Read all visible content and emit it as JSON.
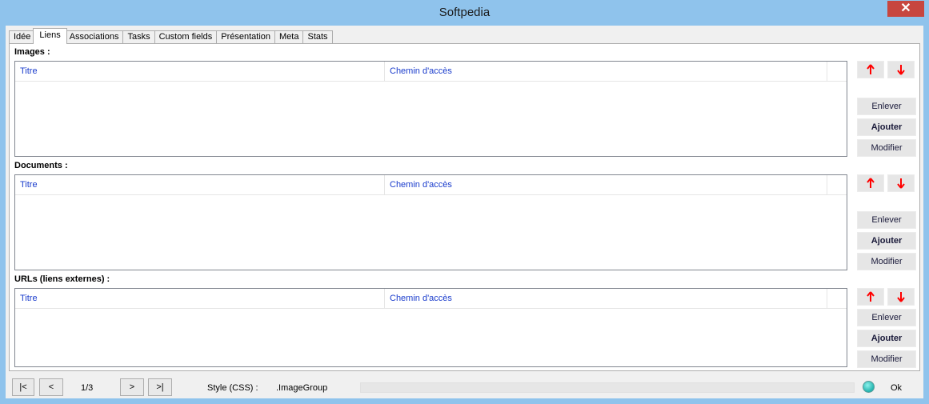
{
  "window": {
    "title": "Softpedia",
    "close_label": "✕"
  },
  "tabs": [
    {
      "label": "Idée"
    },
    {
      "label": "Liens"
    },
    {
      "label": "Associations"
    },
    {
      "label": "Tasks"
    },
    {
      "label": "Custom fields"
    },
    {
      "label": "Présentation"
    },
    {
      "label": "Meta"
    },
    {
      "label": "Stats"
    }
  ],
  "active_tab": "Liens",
  "sections": [
    {
      "label": "Images :",
      "col_titre": "Titre",
      "col_chemin": "Chemin d'accès",
      "btn_remove": "Enlever",
      "btn_add": "Ajouter",
      "btn_edit": "Modifier",
      "up_icon": "arrow-up-icon",
      "down_icon": "arrow-down-icon"
    },
    {
      "label": "Documents :",
      "col_titre": "Titre",
      "col_chemin": "Chemin d'accès",
      "btn_remove": "Enlever",
      "btn_add": "Ajouter",
      "btn_edit": "Modifier",
      "up_icon": "arrow-up-icon",
      "down_icon": "arrow-down-icon"
    },
    {
      "label": "URLs (liens externes) :",
      "col_titre": "Titre",
      "col_chemin": "Chemin d'accès",
      "btn_remove": "Enlever",
      "btn_add": "Ajouter",
      "btn_edit": "Modifier",
      "up_icon": "arrow-up-icon",
      "down_icon": "arrow-down-icon"
    }
  ],
  "navigation": {
    "first": "|<",
    "prev": "<",
    "page": "1/3",
    "next": ">",
    "last": ">|"
  },
  "status": {
    "style_label": "Style (CSS) :",
    "style_value": ".ImageGroup",
    "ok_label": "Ok",
    "progress": 0
  },
  "colors": {
    "accent_arrow": "#ff0000",
    "column_header_text": "#1a3ccc",
    "title_bar": "#8fc3ec",
    "close_button": "#c7463f"
  }
}
